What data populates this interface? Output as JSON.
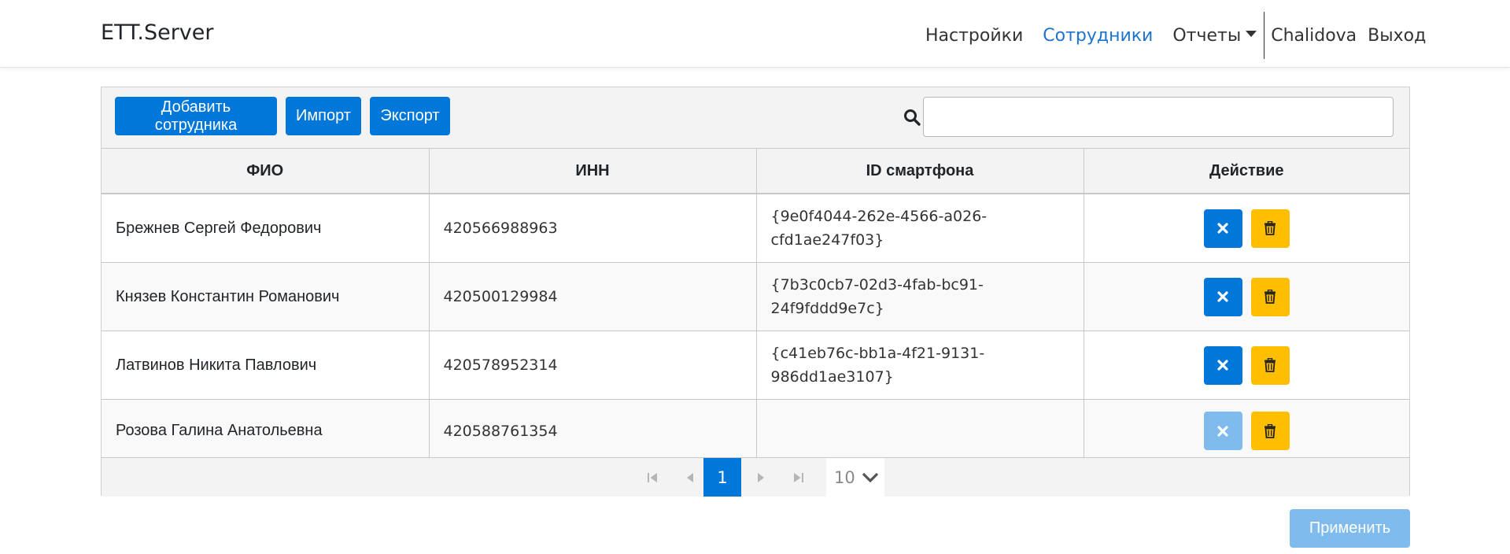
{
  "app": {
    "brand": "ETT.Server"
  },
  "nav": {
    "settings": "Настройки",
    "employees": "Сотрудники",
    "reports": "Отчеты",
    "user": "Chalidova",
    "logout": "Выход"
  },
  "toolbar": {
    "add_label": "Добавить сотрудника",
    "import_label": "Импорт",
    "export_label": "Экспорт",
    "search_placeholder": ""
  },
  "table": {
    "headers": [
      "ФИО",
      "ИНН",
      "ID смартфона",
      "Действие"
    ],
    "rows": [
      {
        "fio": "Брежнев Сергей Федорович",
        "inn": "420566988963",
        "id_line1": "{9e0f4044-262e-4566-a026-",
        "id_line2": "cfd1ae247f03}",
        "unlink_enabled": true
      },
      {
        "fio": "Князев Константин Романович",
        "inn": "420500129984",
        "id_line1": "{7b3c0cb7-02d3-4fab-bc91-",
        "id_line2": "24f9fddd9e7c}",
        "unlink_enabled": true
      },
      {
        "fio": "Латвинов Никита Павлович",
        "inn": "420578952314",
        "id_line1": "{c41eb76c-bb1a-4f21-9131-",
        "id_line2": "986dd1ae3107}",
        "unlink_enabled": true
      },
      {
        "fio": "Розова Галина Анатольевна",
        "inn": "420588761354",
        "id_line1": "",
        "id_line2": "",
        "unlink_enabled": false
      }
    ]
  },
  "pager": {
    "current_page": "1",
    "page_size": "10"
  },
  "footer": {
    "apply_label": "Применить"
  },
  "colors": {
    "primary": "#0077d9",
    "primary_disabled": "#7fbbec",
    "warning": "#ffbe00",
    "nav_active": "#1e73cf"
  },
  "icons": [
    "search-icon",
    "close-icon",
    "trash-icon",
    "first-page-icon",
    "prev-page-icon",
    "next-page-icon",
    "last-page-icon",
    "chevron-down-icon",
    "caret-down-icon"
  ]
}
